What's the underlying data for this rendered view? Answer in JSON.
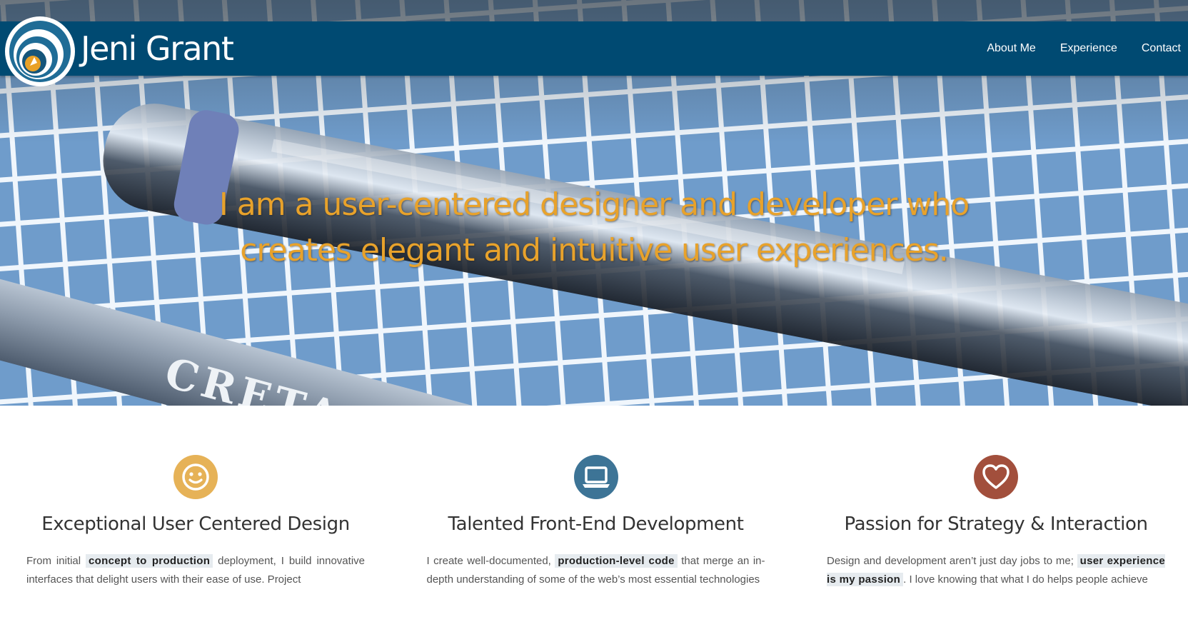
{
  "brand": {
    "name": "Jeni Grant",
    "logo_icon": "spiral-logo-icon"
  },
  "nav": {
    "items": [
      {
        "label": "About Me"
      },
      {
        "label": "Experience"
      },
      {
        "label": "Contact"
      }
    ]
  },
  "hero": {
    "headline_line1": "I am a user-centered designer and developer who",
    "headline_line2": "creates elegant and intuitive user experiences.",
    "photo_text": "CRETAC"
  },
  "features": [
    {
      "icon": "smiley-icon",
      "color": "#e6b257",
      "title": "Exceptional User Centered Design",
      "text_before": "From initial ",
      "highlight": "concept to production",
      "text_after": " deployment, I build innovative interfaces that delight users with their ease of use. Project"
    },
    {
      "icon": "laptop-icon",
      "color": "#3d7496",
      "title": "Talented Front-End Development",
      "text_before": "I create well-documented, ",
      "highlight": "production-level code",
      "text_after": " that merge an in-depth understanding of some of the web’s most essential technologies"
    },
    {
      "icon": "heart-icon",
      "color": "#a24f3c",
      "title": "Passion for Strategy & Interaction",
      "text_before": "Design and development aren’t just day jobs to me; ",
      "highlight": "user experience is my passion",
      "text_after": ". I love knowing that what I do helps people achieve"
    }
  ],
  "colors": {
    "navbar": "#004a72",
    "headline": "#e8a22b",
    "text": "#555555"
  }
}
